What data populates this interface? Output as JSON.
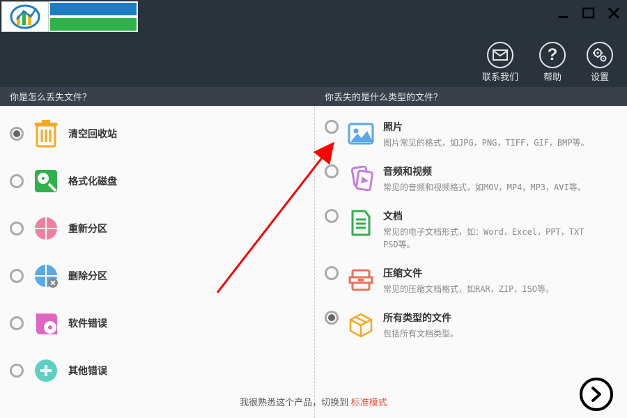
{
  "header": {
    "contact": "联系我们",
    "help": "帮助",
    "settings": "设置"
  },
  "questions": {
    "left": "你是怎么丢失文件？",
    "right": "你丢失的是什么类型的文件？"
  },
  "left_options": [
    {
      "label": "清空回收站",
      "selected": true,
      "icon": "trash"
    },
    {
      "label": "格式化磁盘",
      "selected": false,
      "icon": "disk"
    },
    {
      "label": "重新分区",
      "selected": false,
      "icon": "pie-pink"
    },
    {
      "label": "删除分区",
      "selected": false,
      "icon": "pie-blue"
    },
    {
      "label": "软件错误",
      "selected": false,
      "icon": "cd"
    },
    {
      "label": "其他错误",
      "selected": false,
      "icon": "plus"
    }
  ],
  "right_options": [
    {
      "title": "照片",
      "desc": "图片常见的格式，如JPG，PNG，TIFF，GIF，BMP等。",
      "selected": false,
      "icon": "image"
    },
    {
      "title": "音频和视频",
      "desc": "常见的音频和视频格式，如MOV，MP4，MP3，AVI等。",
      "selected": false,
      "icon": "media"
    },
    {
      "title": "文档",
      "desc": "常见的电子文档形式，如：Word，Excel，PPT，TXT PSD等。",
      "selected": false,
      "icon": "doc"
    },
    {
      "title": "压缩文件",
      "desc": "常见的压缩文档格式，如RAR，ZIP，ISO等。",
      "selected": false,
      "icon": "archive"
    },
    {
      "title": "所有类型的文件",
      "desc": "包括所有文档类型。",
      "selected": true,
      "icon": "box"
    }
  ],
  "footer": {
    "text_a": "我很熟悉这个产品，切换到 ",
    "mode_link": "标准模式"
  }
}
